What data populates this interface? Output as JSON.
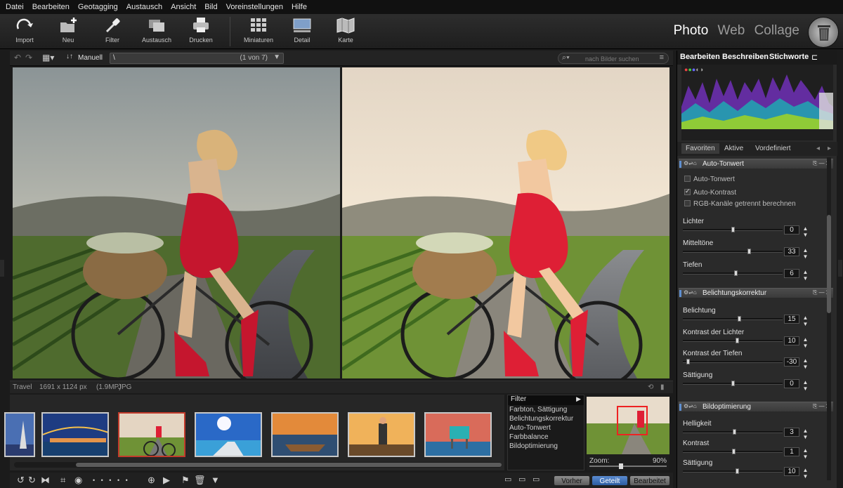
{
  "menu": [
    "Datei",
    "Bearbeiten",
    "Geotagging",
    "Austausch",
    "Ansicht",
    "Bild",
    "Voreinstellungen",
    "Hilfe"
  ],
  "toolbar": {
    "import": "Import",
    "neu": "Neu",
    "filter": "Filter",
    "austausch": "Austausch",
    "drucken": "Drucken",
    "miniaturen": "Miniaturen",
    "detail": "Detail",
    "karte": "Karte"
  },
  "modes": {
    "photo": "Photo",
    "web": "Web",
    "collage": "Collage"
  },
  "viewer_nav": {
    "sort_label": "Manuell",
    "path": "\\",
    "counter": "(1 von 7)",
    "search_placeholder": "nach Bilder suchen"
  },
  "info": {
    "folder": "Travel",
    "dimensions": "1691 x 1124 px",
    "megapixels": "(1.9MP)",
    "format": "JPG"
  },
  "filter_panel": {
    "title": "Filter",
    "items": [
      "Farbton, Sättigung",
      "Belichtungskorrektur",
      "Auto-Tonwert",
      "Farbbalance",
      "Bildoptimierung"
    ]
  },
  "navigator": {
    "zoom_label": "Zoom:",
    "zoom_value": "90%"
  },
  "view_buttons": {
    "vorher": "Vorher",
    "geteilt": "Geteilt",
    "bearbeitet": "Bearbeitet"
  },
  "right_tabs": {
    "bearbeiten": "Bearbeiten",
    "beschreiben": "Beschreiben",
    "stichworte": "Stichworte"
  },
  "sub_tabs": {
    "favoriten": "Favoriten",
    "aktive": "Aktive",
    "vordefiniert": "Vordefiniert"
  },
  "auto_tonwert": {
    "title": "Auto-Tonwert",
    "options": [
      {
        "label": "Auto-Tonwert",
        "checked": false
      },
      {
        "label": "Auto-Kontrast",
        "checked": true
      },
      {
        "label": "RGB-Kanäle getrennt berechnen",
        "checked": false
      }
    ],
    "sliders": [
      {
        "label": "Lichter",
        "value": "0",
        "pos": 0.5
      },
      {
        "label": "Mitteltöne",
        "value": "33",
        "pos": 0.67
      },
      {
        "label": "Tiefen",
        "value": "6",
        "pos": 0.53
      }
    ]
  },
  "belichtung": {
    "title": "Belichtungskorrektur",
    "sliders": [
      {
        "label": "Belichtung",
        "value": "15",
        "pos": 0.57
      },
      {
        "label": "Kontrast der Lichter",
        "value": "10",
        "pos": 0.55
      },
      {
        "label": "Kontrast der Tiefen",
        "value": "-30",
        "pos": 0.04
      },
      {
        "label": "Sättigung",
        "value": "0",
        "pos": 0.5
      }
    ]
  },
  "bildoptimierung": {
    "title": "Bildoptimierung",
    "sliders": [
      {
        "label": "Helligkeit",
        "value": "3",
        "pos": 0.52
      },
      {
        "label": "Kontrast",
        "value": "1",
        "pos": 0.51
      },
      {
        "label": "Sättigung",
        "value": "10",
        "pos": 0.55
      }
    ]
  },
  "colors": {
    "accent": "#2d5ca1",
    "selected_thumb": "#c23b2b",
    "dress": "#c5162e"
  }
}
